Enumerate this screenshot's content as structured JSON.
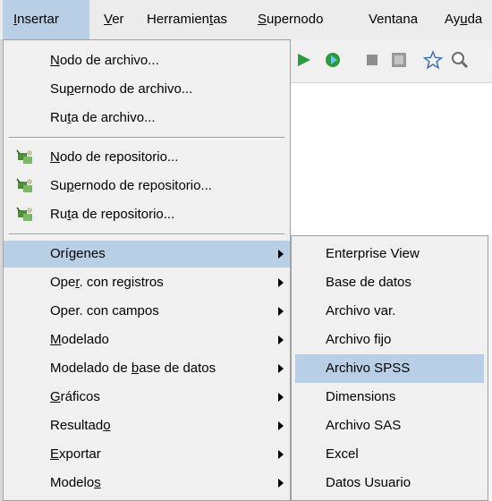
{
  "menubar": {
    "insertar": {
      "u": "I",
      "rest": "nsertar"
    },
    "ver": {
      "u": "V",
      "rest": "er"
    },
    "herramientas": {
      "pre": "Herramien",
      "u": "t",
      "rest": "as"
    },
    "supernodo": {
      "u": "S",
      "rest": "upernodo"
    },
    "ventana": "Ventana",
    "ayuda": {
      "pre": "Ay",
      "u": "u",
      "rest": "da"
    }
  },
  "insert_menu": {
    "nodo_archivo": {
      "u": "N",
      "rest": "odo de archivo..."
    },
    "supernodo_archivo": {
      "pre": "Su",
      "u": "p",
      "rest": "ernodo de archivo..."
    },
    "ruta_archivo": {
      "pre": "Ru",
      "u": "t",
      "rest": "a de archivo..."
    },
    "nodo_repositorio": {
      "u": "N",
      "rest": "odo de repositorio..."
    },
    "supernodo_repositorio": {
      "pre": "Su",
      "u": "p",
      "rest": "ernodo de repositorio..."
    },
    "ruta_repositorio": {
      "pre": "Ru",
      "u": "t",
      "rest": "a de repositorio..."
    },
    "origenes": "Orígenes",
    "oper_registros": {
      "pre": "Ope",
      "u": "r",
      "rest": ". con registros"
    },
    "oper_campos": "Oper. con campos",
    "modelado": {
      "u": "M",
      "rest": "odelado"
    },
    "modelado_bd": {
      "pre": "Modelado de ",
      "u": "b",
      "rest": "ase de datos"
    },
    "graficos": {
      "u": "G",
      "rest": "ráficos"
    },
    "resultado": {
      "pre": "Resultad",
      "u": "o",
      "rest": ""
    },
    "exportar": {
      "u": "E",
      "rest": "xportar"
    },
    "modelos": {
      "pre": "Modelo",
      "u": "s",
      "rest": ""
    }
  },
  "submenu": {
    "items": [
      "Enterprise View",
      "Base de datos",
      "Archivo var.",
      "Archivo fijo",
      "Archivo SPSS",
      "Dimensions",
      "Archivo SAS",
      "Excel",
      "Datos Usuario"
    ]
  },
  "icons": {
    "repository": "repository-icon",
    "arrow": "submenu-arrow-icon"
  },
  "colors": {
    "highlight": "#b8cfe5",
    "menu_bg": "#f0f0f0",
    "menubar_bg": "#ececec"
  }
}
